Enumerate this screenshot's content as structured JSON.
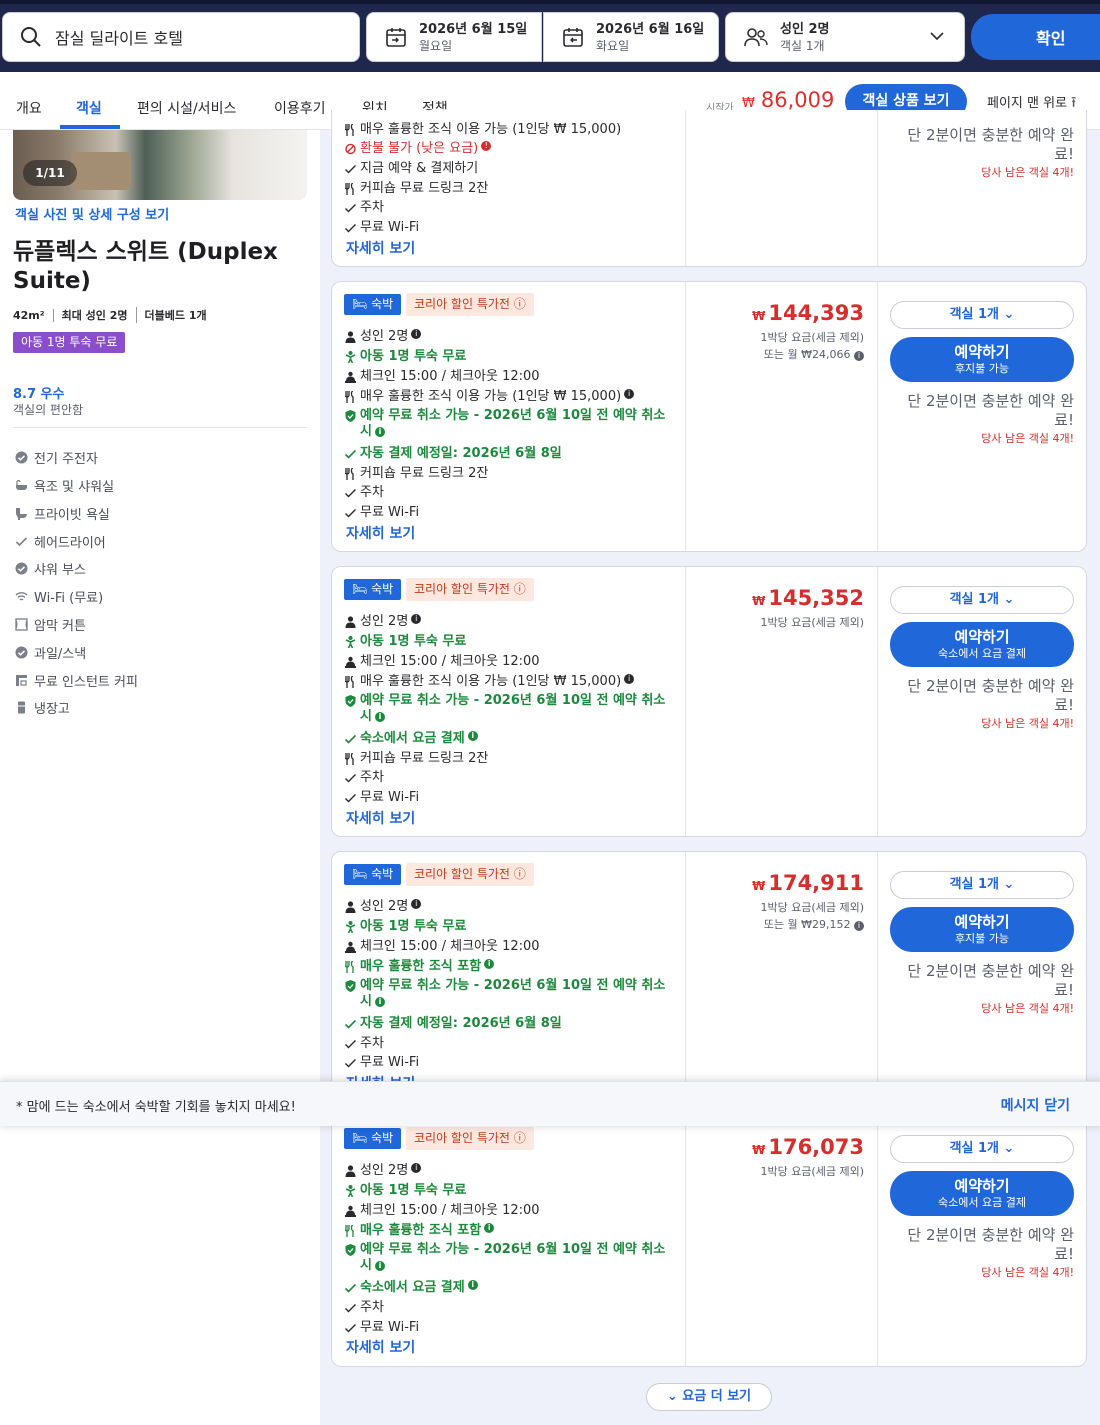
{
  "search": {
    "query": "잠실 딜라이트 호텔"
  },
  "dates": {
    "checkin_date": "2026년 6월 15일",
    "checkin_day": "월요일",
    "checkout_date": "2026년 6월 16일",
    "checkout_day": "화요일"
  },
  "guests": {
    "adults": "성인 2명",
    "rooms": "객실 1개"
  },
  "confirm_label": "확인",
  "tabs": [
    "개요",
    "객실",
    "편의 시설/서비스",
    "이용후기",
    "위치",
    "정책"
  ],
  "header": {
    "from_label": "시작가",
    "currency": "₩",
    "from_price": "86,009",
    "view_rooms_label": "객실 상품 보기",
    "to_top_label": "페이지 맨 위로"
  },
  "room": {
    "photo_counter": "1/11",
    "photo_link": "객실 사진 및 상세 구성 보기",
    "name": "듀플렉스 스위트 (Duplex Suite)",
    "area": "42m²",
    "max_guests": "최대 성인 2명",
    "bed": "더블베드 1개",
    "kid_badge": "아동 1명 투숙 무료",
    "rating": "8.7 우수",
    "rating_sub": "객실의 편안함",
    "amenities": [
      "전기 주전자",
      "욕조 및 샤워실",
      "프라이빗 욕실",
      "헤어드라이어",
      "샤워 부스",
      "Wi-Fi (무료)",
      "암막 커튼",
      "과일/스낵",
      "무료 인스턴트 커피",
      "냉장고"
    ]
  },
  "common": {
    "stay_badge": "숙박",
    "deal_badge": "코리아 할인 특가전",
    "adults": "성인 2명",
    "kid_free": "아동 1명 투숙 무료",
    "checkin": "체크인 15:00 / 체크아웃 12:00",
    "breakfast_optional": "매우 훌륭한 조식 이용 가능 (1인당 ₩ 15,000)",
    "breakfast_included": "매우 훌륭한 조식 포함",
    "free_cancel": "예약 무료 취소 가능 - 2026년 6월 10일 전 예약 취소 시",
    "auto_pay": "자동 결제 예정일: 2026년 6월 8일",
    "pay_at_property": "숙소에서 요금 결제",
    "coffee_drink": "커피숍 무료 드링크 2잔",
    "parking": "주차",
    "wifi": "무료 Wi-Fi",
    "details": "자세히 보기",
    "per_night": "1박당 요금(세금 제외)",
    "rooms_select": "객실 1개",
    "book": "예약하기",
    "pay_later": "후지불 가능",
    "urgency": "단 2분이면 충분한 예약 완료!",
    "rooms_left": "당사 남은 객실 4개!"
  },
  "card0": {
    "breakfast_partial": "매우 훌륭한 조식 이용 가능 (1인당 ₩ 15,000)",
    "nonrefundable": "환불 불가 (낮은 요금)",
    "pay_now": "지금 예약 & 결제하기"
  },
  "offers": [
    {
      "price": "144,393",
      "monthly": "또는 월 ₩24,066"
    },
    {
      "price": "145,352"
    },
    {
      "price": "174,911",
      "monthly": "또는 월 ₩29,152"
    },
    {
      "price": "176,073"
    }
  ],
  "toast": {
    "message": "* 맘에 드는 숙소에서 숙박할 기회를 놓치지 마세요!",
    "close": "메시지 닫기"
  },
  "more_prices": "요금 더 보기",
  "colors": {
    "brand_blue": "#2067da",
    "price_red": "#d62d2d",
    "green": "#1b8a3d",
    "nav_dark": "#20274d",
    "kid_purple": "#8b4ecb"
  }
}
